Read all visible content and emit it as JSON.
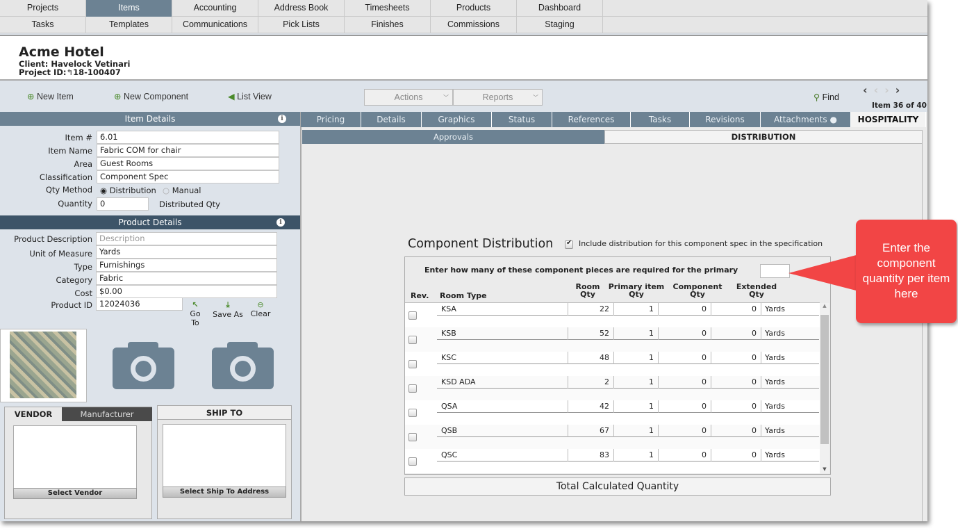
{
  "nav": {
    "row1": [
      "Projects",
      "Items",
      "Accounting",
      "Address Book",
      "Timesheets",
      "Products",
      "Dashboard"
    ],
    "row2": [
      "Tasks",
      "Templates",
      "Communications",
      "Pick Lists",
      "Finishes",
      "Commissions",
      "Staging"
    ],
    "active": "Items"
  },
  "header": {
    "title": "Acme Hotel",
    "client": "Client: Havelock Vetinari",
    "project_label": "Project ID:",
    "project_id": "18-100407"
  },
  "toolbar": {
    "new_item": "New Item",
    "new_component": "New Component",
    "list_view": "List View",
    "actions": "Actions",
    "reports": "Reports",
    "find": "Find",
    "item_counter": "Item 36 of 40"
  },
  "item_details": {
    "title": "Item Details",
    "fields": [
      {
        "label": "Item #",
        "value": "6.01"
      },
      {
        "label": "Item Name",
        "value": "Fabric COM for chair"
      },
      {
        "label": "Area",
        "value": "Guest Rooms"
      },
      {
        "label": "Classification",
        "value": "Component Spec"
      }
    ],
    "qty_method_label": "Qty Method",
    "qty_options": [
      "Distribution",
      "Manual"
    ],
    "qty_selected": "Distribution",
    "quantity_label": "Quantity",
    "quantity": "0",
    "distributed_label": "Distributed Qty"
  },
  "product_details": {
    "title": "Product Details",
    "description_label": "Product Description",
    "description_placeholder": "Description",
    "fields": [
      {
        "label": "Unit of Measure",
        "value": "Yards"
      },
      {
        "label": "Type",
        "value": "Furnishings"
      },
      {
        "label": "Category",
        "value": "Fabric"
      },
      {
        "label": "Cost",
        "value": "$0.00"
      }
    ],
    "product_id_label": "Product ID",
    "product_id": "12024036",
    "go_to": "Go To",
    "save_as": "Save As",
    "clear": "Clear"
  },
  "vendor": {
    "tab_vendor": "VENDOR",
    "tab_manufacturer": "Manufacturer",
    "select": "Select Vendor"
  },
  "ship_to": {
    "title": "SHIP TO",
    "select": "Select Ship To Address"
  },
  "tabs": [
    "Pricing",
    "Details",
    "Graphics",
    "Status",
    "References",
    "Tasks",
    "Revisions",
    "Attachments ●",
    "HOSPITALITY"
  ],
  "active_tab": "HOSPITALITY",
  "subtabs": [
    "Approvals",
    "DISTRIBUTION"
  ],
  "distribution": {
    "title": "Component Distribution",
    "include_label": "Include distribution for this component spec in the specification",
    "include_checked": true,
    "prompt": "Enter how many of these component pieces are required for the primary",
    "prompt_value": "",
    "headers": {
      "rev": "Rev.",
      "room_type": "Room Type",
      "room_qty": "Room Qty",
      "primary_qty": "Primary item Qty",
      "component_qty": "Component Qty",
      "extended_qty": "Extended Qty"
    },
    "rows": [
      {
        "room": "KSA",
        "room_qty": "22",
        "primary": "1",
        "component": "0",
        "extended": "0",
        "unit": "Yards"
      },
      {
        "room": "KSB",
        "room_qty": "52",
        "primary": "1",
        "component": "0",
        "extended": "0",
        "unit": "Yards"
      },
      {
        "room": "KSC",
        "room_qty": "48",
        "primary": "1",
        "component": "0",
        "extended": "0",
        "unit": "Yards"
      },
      {
        "room": "KSD ADA",
        "room_qty": "2",
        "primary": "1",
        "component": "0",
        "extended": "0",
        "unit": "Yards"
      },
      {
        "room": "QSA",
        "room_qty": "42",
        "primary": "1",
        "component": "0",
        "extended": "0",
        "unit": "Yards"
      },
      {
        "room": "QSB",
        "room_qty": "67",
        "primary": "1",
        "component": "0",
        "extended": "0",
        "unit": "Yards"
      },
      {
        "room": "QSC",
        "room_qty": "83",
        "primary": "1",
        "component": "0",
        "extended": "0",
        "unit": "Yards"
      }
    ],
    "total_label": "Total Calculated Quantity"
  },
  "callout": {
    "text": "Enter the component quantity per item here",
    "color": "#f24545"
  }
}
